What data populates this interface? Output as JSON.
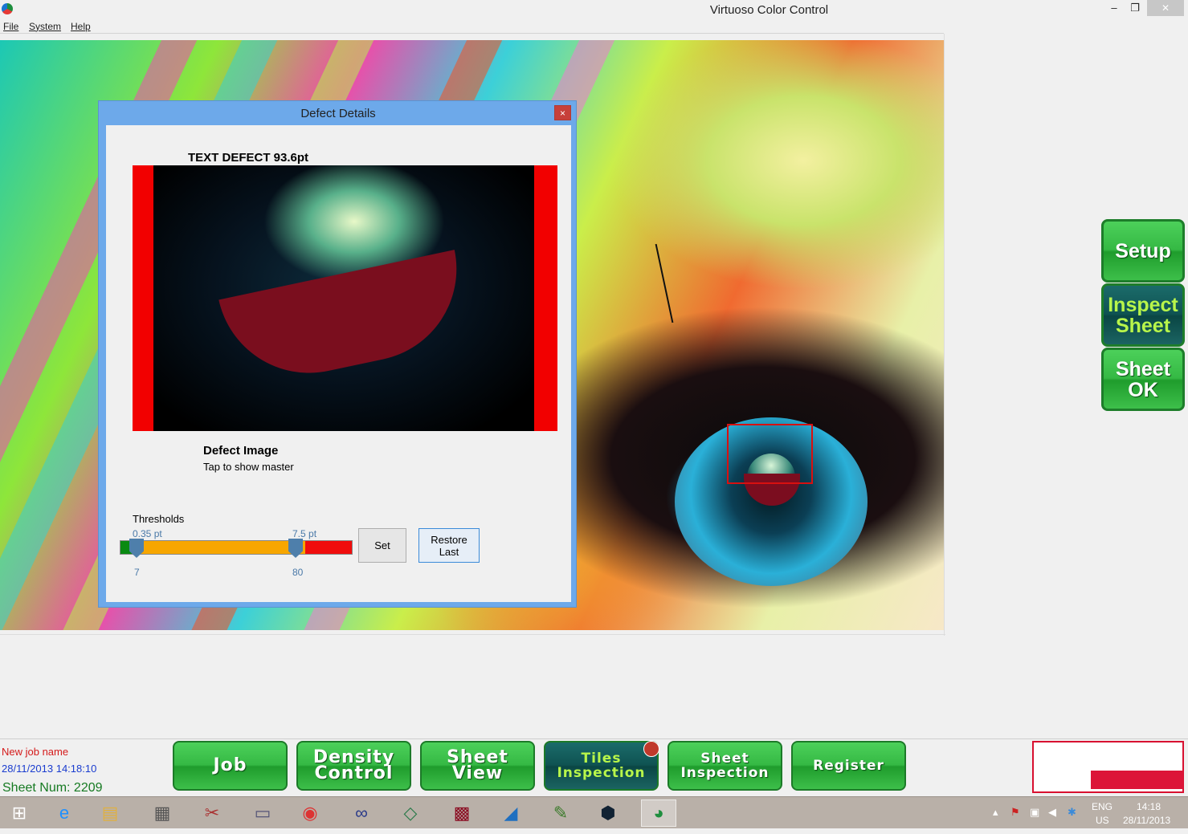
{
  "window": {
    "title": "Virtuoso Color Control"
  },
  "menu": [
    "File",
    "System",
    "Help"
  ],
  "dialog": {
    "title": "Defect Details",
    "close_label": "×",
    "defect_title": "TEXT DEFECT 93.6pt",
    "caption": "Defect Image",
    "subcaption": "Tap to show master",
    "thresholds_label": "Thresholds",
    "low_value": "0.35 pt",
    "high_value": "7.5 pt",
    "low_sub": "7",
    "high_sub": "80",
    "set_label": "Set",
    "restore_label_1": "Restore",
    "restore_label_2": "Last"
  },
  "side_buttons": {
    "setup": "Setup",
    "inspect_1": "Inspect",
    "inspect_2": "Sheet",
    "ok_1": "Sheet",
    "ok_2": "OK"
  },
  "status": {
    "job_name": "New job name",
    "date": "28/11/2013 14:18:10",
    "sheet_num": "Sheet Num: 2209"
  },
  "nav": {
    "job": "Job",
    "density_1": "Density",
    "density_2": "Control",
    "sheetview_1": "Sheet",
    "sheetview_2": "View",
    "tiles_1": "Tiles",
    "tiles_2": "Inspection",
    "sheetinsp_1": "Sheet",
    "sheetinsp_2": "Inspection",
    "register": "Register"
  },
  "taskbar": {
    "lang_1": "ENG",
    "lang_2": "US",
    "time": "14:18",
    "date": "28/11/2013"
  },
  "colors": {
    "accent_green": "#35b944",
    "defect_red": "#d81010",
    "dialog_blue": "#6da9ea"
  }
}
